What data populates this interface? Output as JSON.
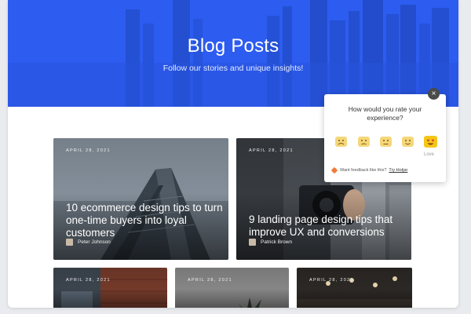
{
  "hero": {
    "title": "Blog Posts",
    "subtitle": "Follow our stories and unique insights!",
    "color": "#2d5cf0"
  },
  "cards": [
    {
      "date": "APRIL 28, 2021",
      "title": "10 ecommerce design tips to turn one-time buyers into loyal customers",
      "author": "Peter Johnson"
    },
    {
      "date": "APRIL 28, 2021",
      "title": "9 landing page design tips that improve UX and conversions",
      "author": "Patrick Brown"
    },
    {
      "date": "APRIL 28, 2021"
    },
    {
      "date": "APRIL 28, 2021"
    },
    {
      "date": "APRIL 28, 2021"
    }
  ],
  "widget": {
    "question": "How would you rate your experience?",
    "selected_label": "Love",
    "faces": [
      "hate-face-icon",
      "dislike-face-icon",
      "neutral-face-icon",
      "like-face-icon",
      "love-face-icon"
    ],
    "footer_text": "Want feedback like this?",
    "footer_link": "Try Hotjar",
    "close_glyph": "×"
  }
}
